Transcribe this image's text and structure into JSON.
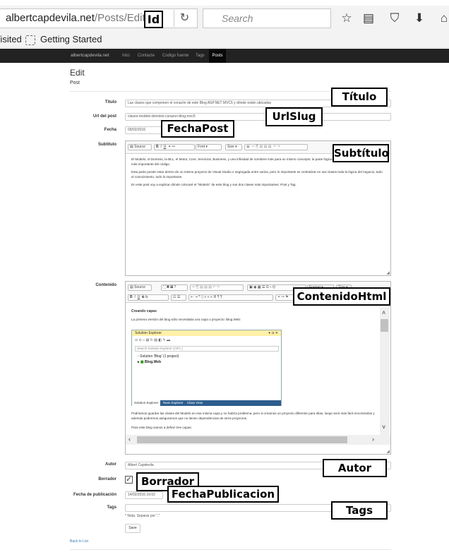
{
  "browser": {
    "url_host": "albertcapdevila.net",
    "url_path": "/Posts/Edit/7",
    "search_placeholder": "Search",
    "bookmarks": [
      "Visited",
      "Getting Started"
    ]
  },
  "navbar": {
    "brand": "albertcapdevila.net",
    "items": [
      "Inici",
      "Contacte",
      "Codigo fuente",
      "Tags",
      "Posts"
    ]
  },
  "page": {
    "title": "Edit",
    "subtitle": "Post",
    "back_link": "Back to List"
  },
  "form": {
    "titulo_label": "Titulo",
    "titulo_value": "Las clases que componen el corazón de este Blog ASP.NET MVC5 y dónde están ubicadas",
    "url_label": "Url del post",
    "url_value": "clases-modelo-dominio-corazon-blog-mvc5",
    "fecha_label": "Fecha",
    "fecha_value": "09/02/2016",
    "subtitulo_label": "Subtitulo",
    "contenido_label": "Contenido",
    "autor_label": "Autor",
    "autor_value": "Albert Capdevila",
    "borrador_label": "Borrador",
    "fecha_pub_label": "Fecha de publicación",
    "fecha_pub_value": "14/02/2016 16:02",
    "tags_label": "Tags",
    "tags_value": "",
    "tags_note": "* Nota. Separar por \",\"",
    "save_label": "Save"
  },
  "editor1": {
    "source_label": "Source",
    "font_label": "Font",
    "size_label": "Size",
    "paragraphs": [
      "El Modelo, el Dominio, la BLL, el Motor, Core, Servicios, Business, y una infinidad de nombres más para un mismo concepto: la parte lógica de un código que situar la parte más importante del código.",
      "Esta parte puede estar dentro de un mismo proyecto de Visual Studio o segregada entre varios, pero lo importante es centralizar en sus clases toda la lógica del negocio, todo el conocimiento, todo lo importante.",
      "En este post voy a explicar dónde colocaré el \"Modelo\" de este blog y sus dos clases más importantes: Post y Tag."
    ]
  },
  "editor2": {
    "source_label": "Source",
    "format_label": "Format",
    "size_label": "Size",
    "heading": "Creando capas",
    "intro": "La primera versión del blog sólo necesitaba una capa o proyecto: Blog.Web:",
    "solex": {
      "title": "Solution Explorer",
      "search": "Search Solution Explorer (Ctrl+;)",
      "solution": "Solution 'Blog' (1 project)",
      "project": "Blog.Web",
      "tabs": [
        "Solution Explorer",
        "Team Explorer",
        "Class View"
      ]
    },
    "para2": "Podríamos guardar las clases del Modelo en esa misma capa y no habría problema, pero si creamos un proyecto diferente para ellas, luego será más fácil encontrarlas y además podremos asegurarnos que no tienen dependencias de otros proyectos.",
    "para3": "Para este blog vamos a definir tres capas:"
  },
  "annotations": {
    "id": "Id",
    "titulo": "Título",
    "urlslug": "UrlSlug",
    "fechapost": "FechaPost",
    "subtitulo": "Subtítulo",
    "contenido": "ContenidoHtml",
    "autor": "Autor",
    "borrador": "Borrador",
    "fechapub": "FechaPublicacion",
    "tags": "Tags"
  }
}
